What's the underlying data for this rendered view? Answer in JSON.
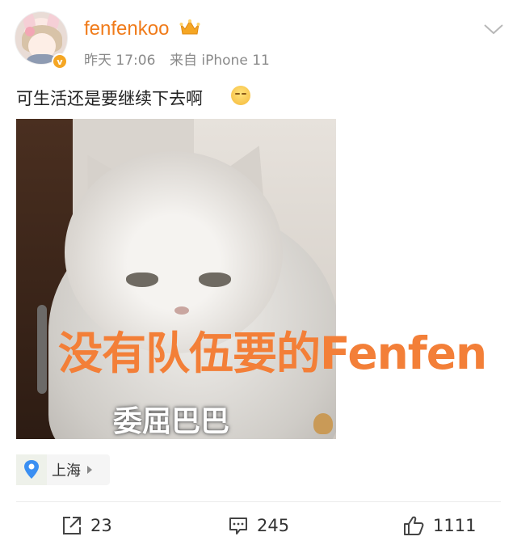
{
  "post": {
    "username": "fenfenkoo",
    "time": "昨天 17:06",
    "source": "来自 iPhone 11",
    "text": "可生活还是要继续下去啊",
    "verify_mark": "v"
  },
  "photo": {
    "caption_small": "委屈巴巴",
    "overlay_text": "没有队伍要的Fenfen"
  },
  "location": {
    "label": "上海"
  },
  "actions": {
    "repost_count": "23",
    "comment_count": "245",
    "like_count": "1111"
  },
  "colors": {
    "username": "#f07b1a",
    "overlay_text": "#f37f38",
    "muted": "#8a8a8a",
    "location_pin": "#3a8ff2",
    "vip_crown": "#f5a623"
  },
  "icons": {
    "vip": "crown-icon",
    "dropdown": "chevron-down-icon",
    "location": "location-pin-icon",
    "repost": "repost-icon",
    "comment": "comment-icon",
    "like": "thumbs-up-icon"
  }
}
